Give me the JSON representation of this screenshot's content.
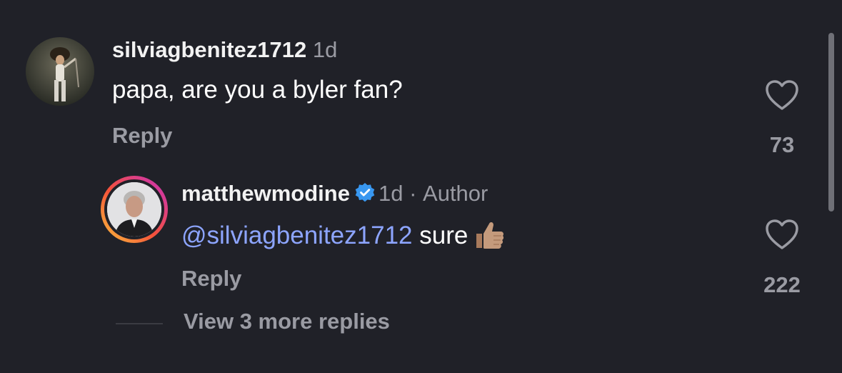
{
  "comments": [
    {
      "username": "silviagbenitez1712",
      "time": "1d",
      "text": "papa, are you a byler fan?",
      "reply_label": "Reply",
      "likes": "73",
      "avatar_icon": "concert-performer-avatar"
    },
    {
      "username": "matthewmodine",
      "verified": true,
      "time": "1d",
      "separator": "·",
      "author_label": "Author",
      "mention": "@silviagbenitez1712",
      "text": "sure",
      "emoji": "thumbs-up-icon",
      "reply_label": "Reply",
      "likes": "222",
      "avatar_icon": "gray-haired-man-avatar"
    }
  ],
  "view_more_label": "View 3 more replies",
  "colors": {
    "background": "#202128",
    "mention": "#8da5ff",
    "verified": "#3897f0",
    "muted": "#9a9ba3"
  }
}
